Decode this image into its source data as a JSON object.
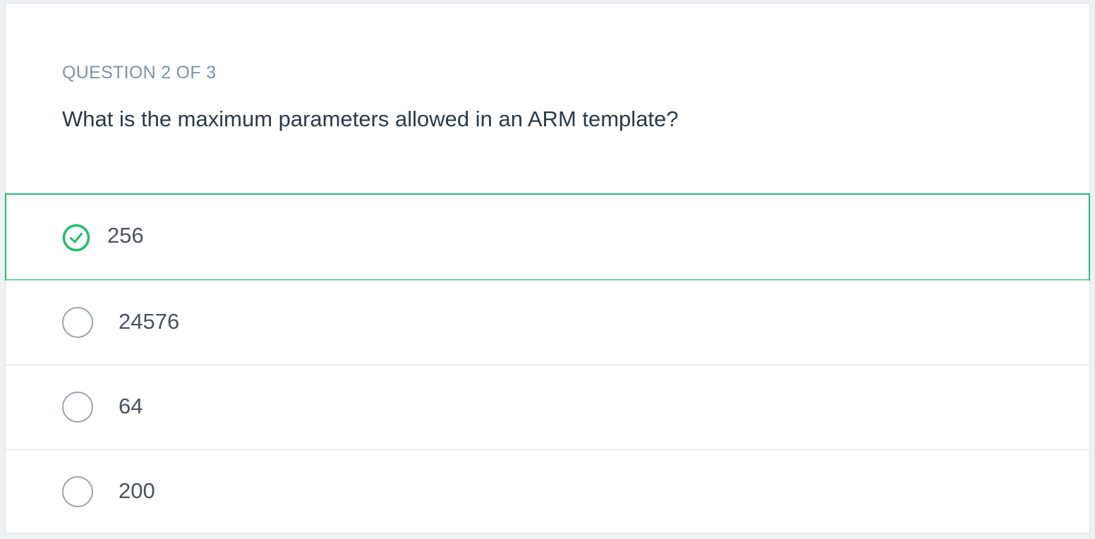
{
  "quiz": {
    "counter": "QUESTION 2 OF 3",
    "question": "What is the maximum parameters allowed in an ARM template?",
    "options": [
      {
        "label": "256",
        "selected": true
      },
      {
        "label": "24576",
        "selected": false
      },
      {
        "label": "64",
        "selected": false
      },
      {
        "label": "200",
        "selected": false
      }
    ]
  },
  "colors": {
    "accent": "#1fbf6b",
    "counter_text": "#7d93a8",
    "question_text": "#2b3a4a",
    "radio_border": "#9aa3ad"
  },
  "icons": {
    "selected": "check-circle-icon",
    "unselected": "radio-circle-icon"
  }
}
